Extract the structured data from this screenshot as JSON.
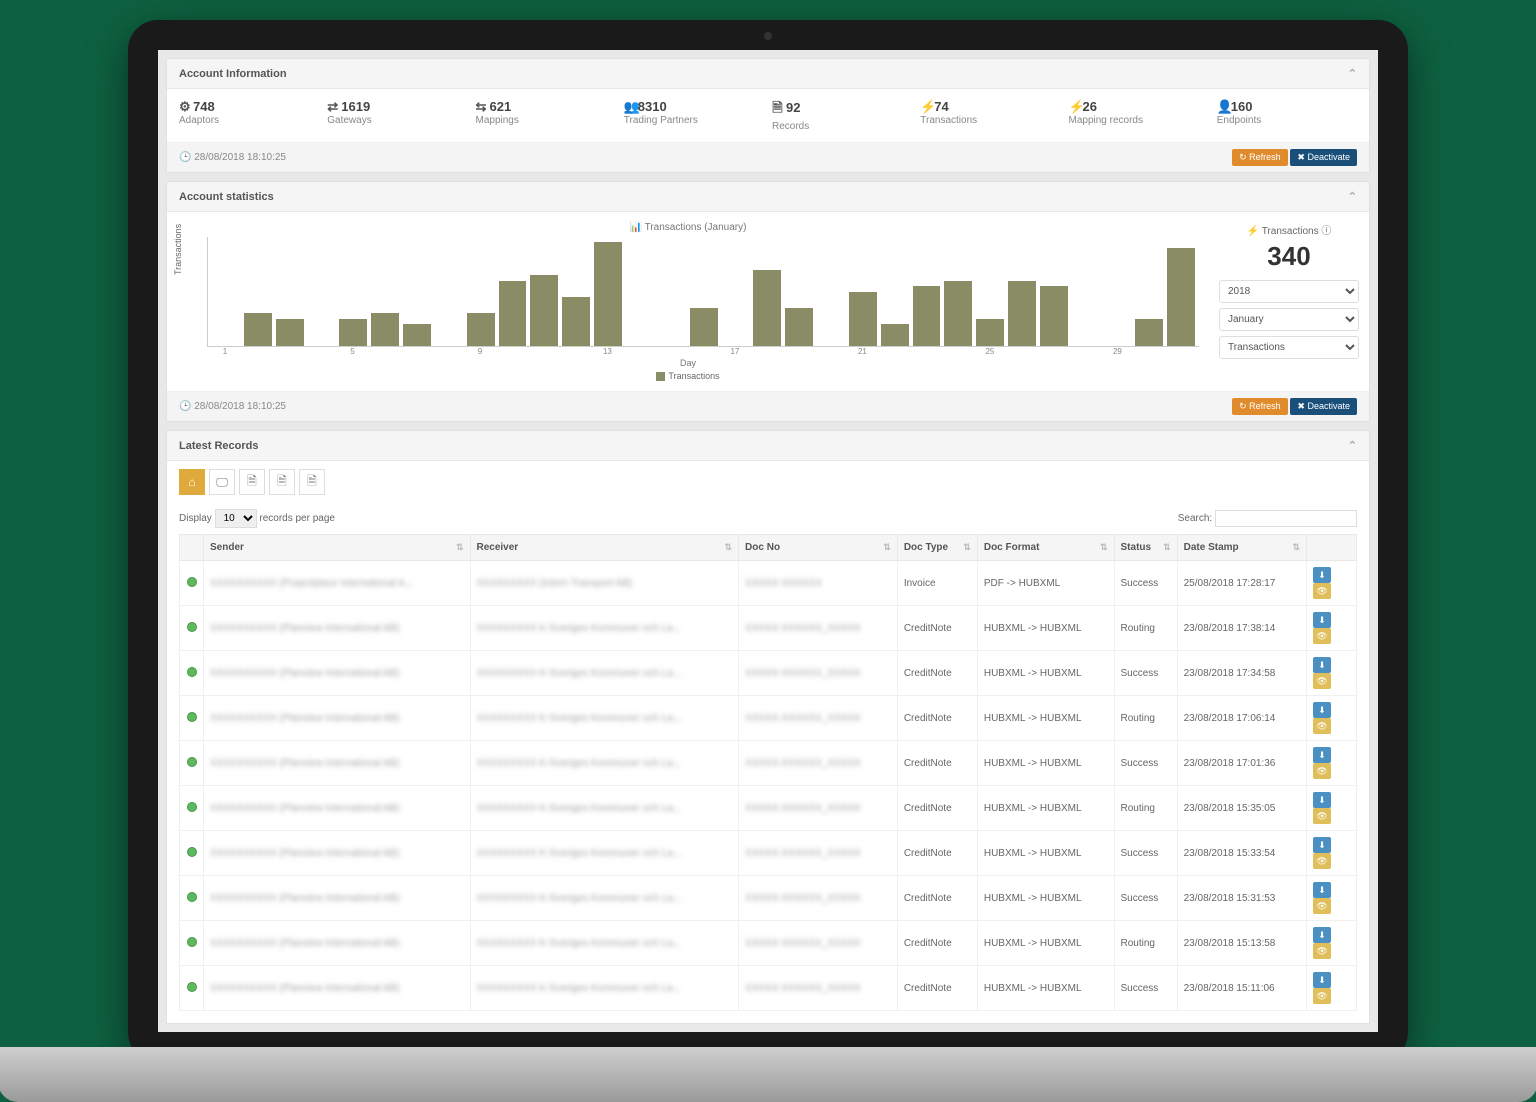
{
  "account_info": {
    "title": "Account Information",
    "stats": [
      {
        "icon": "⚙",
        "value": "748",
        "label": "Adaptors"
      },
      {
        "icon": "⇄",
        "value": "1619",
        "label": "Gateways"
      },
      {
        "icon": "⇆",
        "value": "621",
        "label": "Mappings"
      },
      {
        "icon": "👥",
        "value": "8310",
        "label": "Trading Partners"
      },
      {
        "icon": "🗎",
        "value": "92",
        "label": "Records"
      },
      {
        "icon": "⚡",
        "value": "74",
        "label": "Transactions"
      },
      {
        "icon": "⚡",
        "value": "26",
        "label": "Mapping records"
      },
      {
        "icon": "👤",
        "value": "160",
        "label": "Endpoints"
      }
    ],
    "timestamp": "28/08/2018 18:10:25",
    "refresh": "↻ Refresh",
    "deactivate": "✖ Deactivate"
  },
  "account_stats": {
    "title": "Account statistics",
    "chart_title": "📊 Transactions (January)",
    "ylabel": "Transactions",
    "xlabel": "Day",
    "legend": "Transactions",
    "side_title": "⚡ Transactions ⓘ",
    "side_value": "340",
    "select_year": "2018",
    "select_month": "January",
    "select_metric": "Transactions",
    "timestamp": "28/08/2018 18:10:25",
    "refresh": "↻ Refresh",
    "deactivate": "✖ Deactivate"
  },
  "chart_data": {
    "type": "bar",
    "title": "Transactions (January)",
    "xlabel": "Day",
    "ylabel": "Transactions",
    "ylim": [
      0,
      40
    ],
    "categories": [
      "1",
      "2",
      "3",
      "4",
      "5",
      "6",
      "7",
      "8",
      "9",
      "10",
      "11",
      "12",
      "13",
      "14",
      "15",
      "16",
      "17",
      "18",
      "19",
      "20",
      "21",
      "22",
      "23",
      "24",
      "25",
      "26",
      "27",
      "28",
      "29",
      "30",
      "31"
    ],
    "values": [
      0,
      12,
      10,
      0,
      10,
      12,
      8,
      0,
      12,
      24,
      26,
      18,
      38,
      0,
      0,
      14,
      0,
      28,
      14,
      0,
      20,
      8,
      22,
      24,
      10,
      24,
      22,
      0,
      0,
      10,
      36
    ]
  },
  "latest_records": {
    "title": "Latest Records",
    "display_label": "Display",
    "display_value": "10",
    "display_suffix": "records per page",
    "search_label": "Search:",
    "headers": [
      "",
      "Sender",
      "Receiver",
      "Doc No",
      "Doc Type",
      "Doc Format",
      "Status",
      "Date Stamp",
      ""
    ],
    "rows": [
      {
        "sender": "XXXXXXXXXX (Projectplace International A...",
        "receiver": "XXXXXXXXX (Intern Transport AB)",
        "docno": "XXXXX-XXXXXX",
        "doctype": "Invoice",
        "docformat": "PDF -> HUBXML",
        "status": "Success",
        "date": "25/08/2018 17:28:17"
      },
      {
        "sender": "XXXXXXXXXX (Planview International AB)",
        "receiver": "XXXXXXXXX K-Sveriges Kommuner och La...",
        "docno": "XXXXX-XXXXXX_XXXXX",
        "doctype": "CreditNote",
        "docformat": "HUBXML -> HUBXML",
        "status": "Routing",
        "date": "23/08/2018 17:38:14"
      },
      {
        "sender": "XXXXXXXXXX (Planview International AB)",
        "receiver": "XXXXXXXXX K-Sveriges Kommuner och La...",
        "docno": "XXXXX-XXXXXX_XXXXX",
        "doctype": "CreditNote",
        "docformat": "HUBXML -> HUBXML",
        "status": "Success",
        "date": "23/08/2018 17:34:58"
      },
      {
        "sender": "XXXXXXXXXX (Planview International AB)",
        "receiver": "XXXXXXXXX K-Sveriges Kommuner och La...",
        "docno": "XXXXX-XXXXXX_XXXXX",
        "doctype": "CreditNote",
        "docformat": "HUBXML -> HUBXML",
        "status": "Routing",
        "date": "23/08/2018 17:06:14"
      },
      {
        "sender": "XXXXXXXXXX (Planview International AB)",
        "receiver": "XXXXXXXXX K-Sveriges Kommuner och La...",
        "docno": "XXXXX-XXXXXX_XXXXX",
        "doctype": "CreditNote",
        "docformat": "HUBXML -> HUBXML",
        "status": "Success",
        "date": "23/08/2018 17:01:36"
      },
      {
        "sender": "XXXXXXXXXX (Planview International AB)",
        "receiver": "XXXXXXXXX K-Sveriges Kommuner och La...",
        "docno": "XXXXX-XXXXXX_XXXXX",
        "doctype": "CreditNote",
        "docformat": "HUBXML -> HUBXML",
        "status": "Routing",
        "date": "23/08/2018 15:35:05"
      },
      {
        "sender": "XXXXXXXXXX (Planview International AB)",
        "receiver": "XXXXXXXXX K-Sveriges Kommuner och La...",
        "docno": "XXXXX-XXXXXX_XXXXX",
        "doctype": "CreditNote",
        "docformat": "HUBXML -> HUBXML",
        "status": "Success",
        "date": "23/08/2018 15:33:54"
      },
      {
        "sender": "XXXXXXXXXX (Planview International AB)",
        "receiver": "XXXXXXXXX K-Sveriges Kommuner och La...",
        "docno": "XXXXX-XXXXXX_XXXXX",
        "doctype": "CreditNote",
        "docformat": "HUBXML -> HUBXML",
        "status": "Success",
        "date": "23/08/2018 15:31:53"
      },
      {
        "sender": "XXXXXXXXXX (Planview International AB)",
        "receiver": "XXXXXXXXX K-Sveriges Kommuner och La...",
        "docno": "XXXXX-XXXXXX_XXXXX",
        "doctype": "CreditNote",
        "docformat": "HUBXML -> HUBXML",
        "status": "Routing",
        "date": "23/08/2018 15:13:58"
      },
      {
        "sender": "XXXXXXXXXX (Planview International AB)",
        "receiver": "XXXXXXXXX K-Sveriges Kommuner och La...",
        "docno": "XXXXX-XXXXXX_XXXXX",
        "doctype": "CreditNote",
        "docformat": "HUBXML -> HUBXML",
        "status": "Success",
        "date": "23/08/2018 15:11:06"
      }
    ]
  }
}
